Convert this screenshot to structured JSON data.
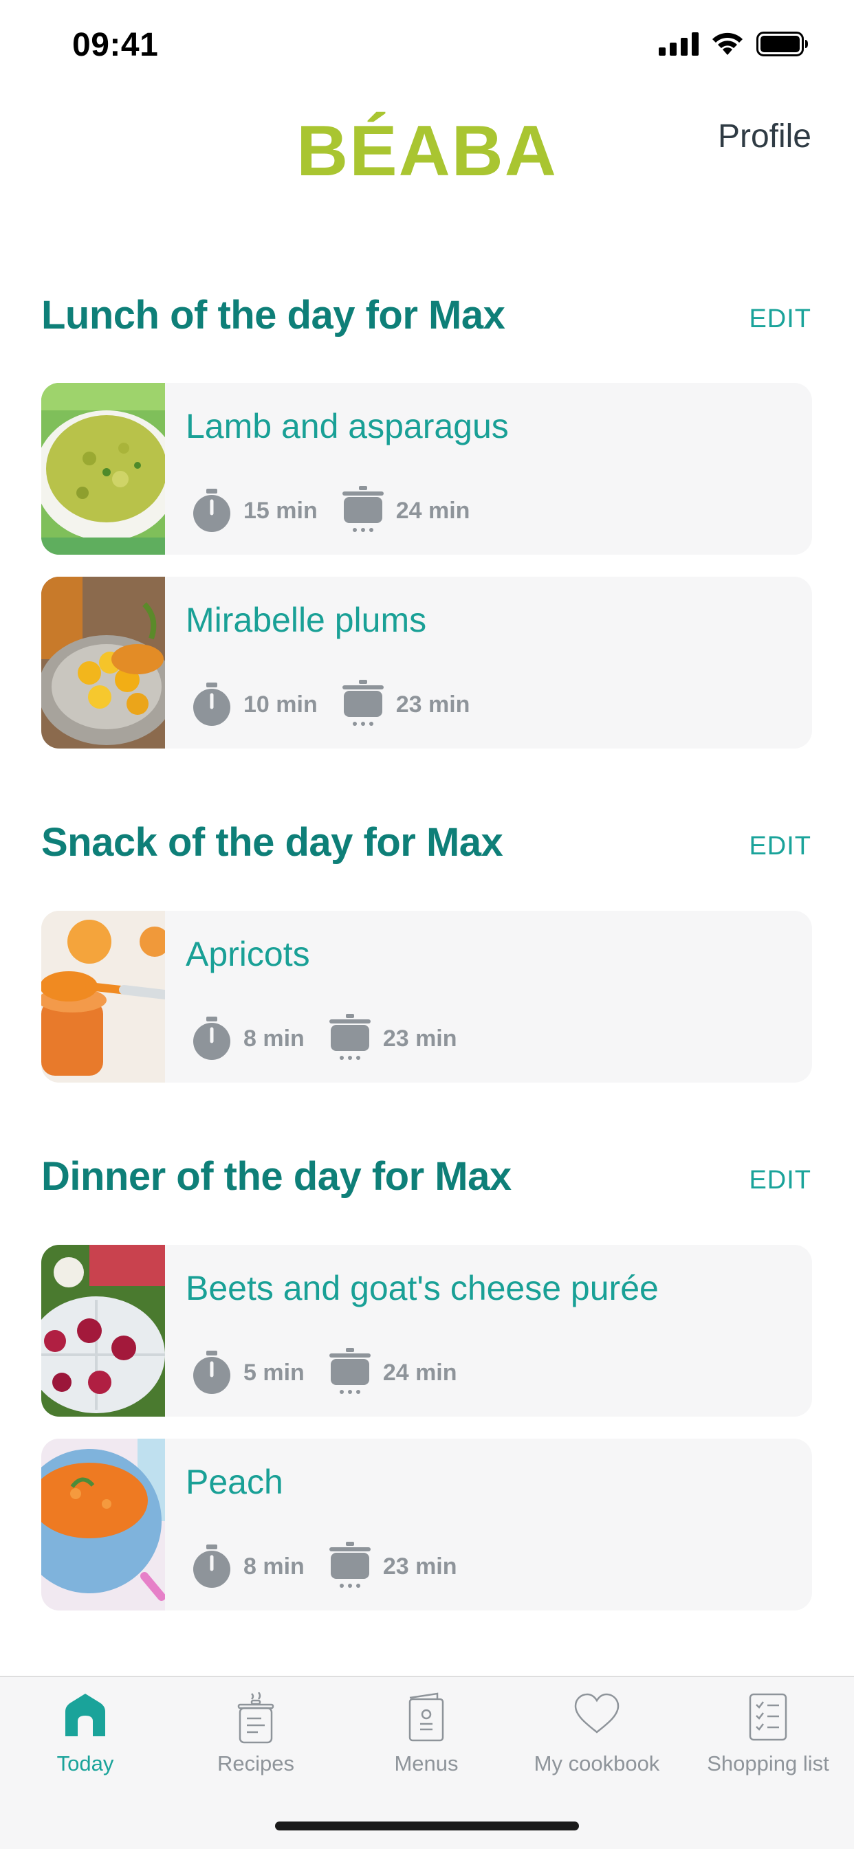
{
  "status_bar": {
    "time": "09:41",
    "icons": [
      "signal-icon",
      "wifi-icon",
      "battery-icon"
    ]
  },
  "header": {
    "logo": "BÉABA",
    "profile_label": "Profile"
  },
  "sections": [
    {
      "title": "Lunch of the day for Max",
      "edit_label": "EDIT",
      "recipes": [
        {
          "name": "Lamb and asparagus",
          "prep_time": "15 min",
          "cook_time": "24 min"
        },
        {
          "name": "Mirabelle plums",
          "prep_time": "10 min",
          "cook_time": "23 min"
        }
      ]
    },
    {
      "title": "Snack of the day for Max",
      "edit_label": "EDIT",
      "recipes": [
        {
          "name": "Apricots",
          "prep_time": "8 min",
          "cook_time": "23 min"
        }
      ]
    },
    {
      "title": "Dinner of the day for Max",
      "edit_label": "EDIT",
      "recipes": [
        {
          "name": "Beets and goat's cheese purée",
          "prep_time": "5 min",
          "cook_time": "24 min"
        },
        {
          "name": "Peach",
          "prep_time": "8 min",
          "cook_time": "23 min"
        }
      ]
    }
  ],
  "tab_bar": {
    "tabs": [
      {
        "label": "Today",
        "icon": "home-icon",
        "active": true
      },
      {
        "label": "Recipes",
        "icon": "recipe-pot-icon",
        "active": false
      },
      {
        "label": "Menus",
        "icon": "menu-card-icon",
        "active": false
      },
      {
        "label": "My cookbook",
        "icon": "heart-icon",
        "active": false
      },
      {
        "label": "Shopping list",
        "icon": "checklist-icon",
        "active": false
      }
    ]
  },
  "colors": {
    "brand_green": "#a9c531",
    "teal_title": "#0e7f78",
    "teal_accent": "#1aa39a",
    "meta_gray": "#8e949a",
    "card_bg": "#f6f6f7"
  }
}
